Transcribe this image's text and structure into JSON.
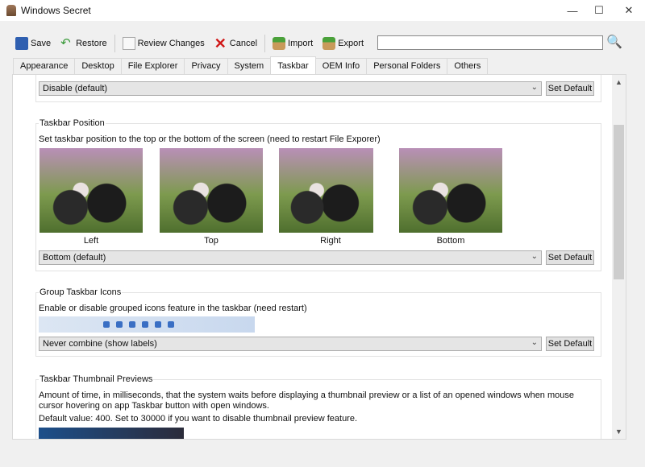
{
  "window": {
    "title": "Windows Secret",
    "minimize": "—",
    "maximize": "☐",
    "close": "✕"
  },
  "toolbar": {
    "save": "Save",
    "restore": "Restore",
    "review": "Review Changes",
    "cancel": "Cancel",
    "import": "Import",
    "export": "Export",
    "search_value": ""
  },
  "tabs": [
    "Appearance",
    "Desktop",
    "File Explorer",
    "Privacy",
    "System",
    "Taskbar",
    "OEM Info",
    "Personal Folders",
    "Others"
  ],
  "active_tab": "Taskbar",
  "top_combo": {
    "value": "Disable (default)",
    "set_default": "Set Default"
  },
  "position": {
    "title": "Taskbar Position",
    "desc": "Set taskbar position to the top or the bottom of the screen  (need to restart File Exporer)",
    "options": [
      "Left",
      "Top",
      "Right",
      "Bottom"
    ],
    "value": "Bottom (default)",
    "set_default": "Set Default"
  },
  "group": {
    "title": "Group Taskbar Icons",
    "desc": "Enable or disable  grouped icons feature in the taskbar (need restart)",
    "value": "Never combine (show labels)",
    "set_default": "Set Default"
  },
  "thumb": {
    "title": "Taskbar Thumbnail Previews",
    "desc": "Amount of time, in milliseconds, that the system waits before displaying a thumbnail preview or a list of an opened windows when mouse cursor hovering on app Taskbar button with open windows.",
    "default": "Default value: 400. Set to 30000 if you want to disable thumbnail preview feature."
  }
}
